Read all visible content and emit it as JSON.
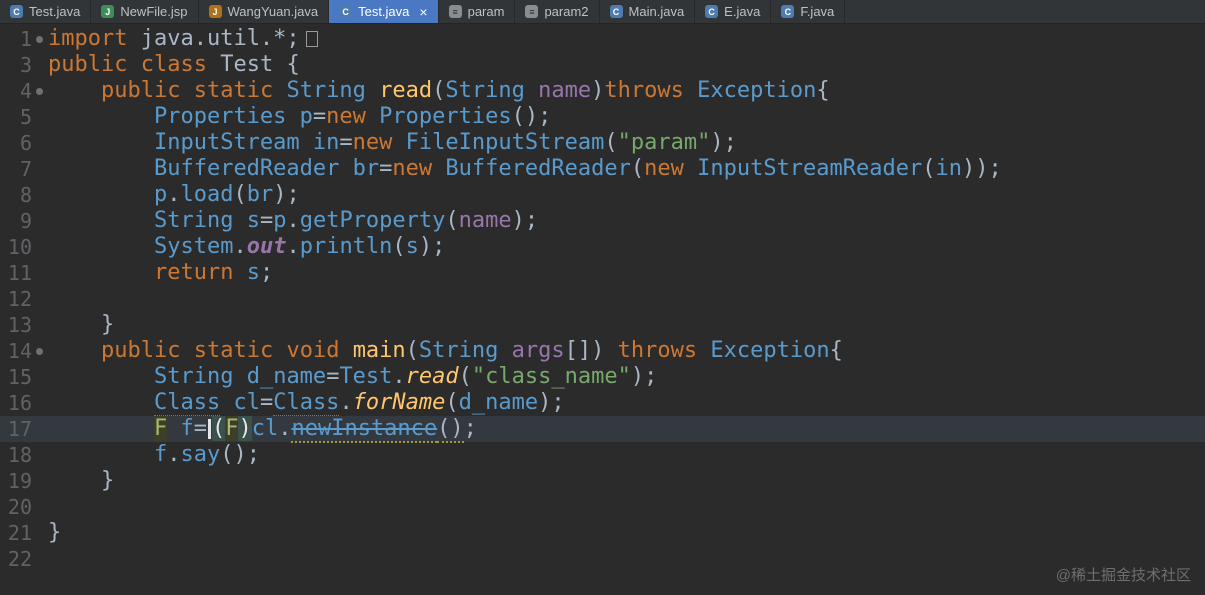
{
  "colors": {
    "editor_bg": "#2B2B2B",
    "tabbar_bg": "#313537",
    "tab_fg": "#BDC1C6",
    "active_tab_bg": "#4A78C2",
    "active_tab_fg": "#FFFFFF",
    "caret_row_bg": "#343940",
    "line_number": "#606366",
    "keyword": "#CC7832",
    "plain": "#A9B7C6",
    "identifier": "#5A9BCE",
    "string": "#79A86B",
    "method_decl": "#FFC66D",
    "static_method": "#FFC66D",
    "field": "#9876AA",
    "parameter": "#9876AA",
    "warn_underline": "#9D9D3A",
    "brace_match_bg": "#3B514D",
    "occurrence_bg": "#3D3E2A"
  },
  "tab_bar": {
    "tabs": [
      {
        "label": "Test.java",
        "icon": "java",
        "active": false
      },
      {
        "label": "NewFile.jsp",
        "icon": "jsp",
        "active": false
      },
      {
        "label": "WangYuan.java",
        "icon": "javafile",
        "active": false
      },
      {
        "label": "Test.java",
        "icon": "java",
        "active": true,
        "close": "×"
      },
      {
        "label": "param",
        "icon": "text",
        "active": false
      },
      {
        "label": "param2",
        "icon": "text",
        "active": false
      },
      {
        "label": "Main.java",
        "icon": "java",
        "active": false
      },
      {
        "label": "E.java",
        "icon": "java",
        "active": false
      },
      {
        "label": "F.java",
        "icon": "java",
        "active": false
      }
    ]
  },
  "editor": {
    "lines": [
      {
        "n": "1",
        "dot": true,
        "fold": true,
        "cur": false,
        "tokens": [
          [
            "kw",
            "import"
          ],
          [
            "pl",
            " java.util.*;"
          ],
          [
            "fold",
            ""
          ]
        ]
      },
      {
        "n": "3",
        "dot": false,
        "cur": false,
        "tokens": [
          [
            "kw",
            "public"
          ],
          [
            "pl",
            " "
          ],
          [
            "kw",
            "class"
          ],
          [
            "pl",
            " Test {"
          ]
        ]
      },
      {
        "n": "4",
        "dot": true,
        "cur": false,
        "tokens": [
          [
            "pl",
            "    "
          ],
          [
            "kw",
            "public"
          ],
          [
            "pl",
            " "
          ],
          [
            "kw",
            "static"
          ],
          [
            "pl",
            " "
          ],
          [
            "id",
            "String"
          ],
          [
            "pl",
            " "
          ],
          [
            "mdecl",
            "read"
          ],
          [
            "pl",
            "("
          ],
          [
            "id",
            "String"
          ],
          [
            "pl",
            " "
          ],
          [
            "prm",
            "name"
          ],
          [
            "pl",
            ")"
          ],
          [
            "kw",
            "throws"
          ],
          [
            "pl",
            " "
          ],
          [
            "id",
            "Exception"
          ],
          [
            "pl",
            "{"
          ]
        ]
      },
      {
        "n": "5",
        "dot": false,
        "cur": false,
        "tokens": [
          [
            "pl",
            "        "
          ],
          [
            "id",
            "Properties"
          ],
          [
            "pl",
            " "
          ],
          [
            "id",
            "p"
          ],
          [
            "pl",
            "="
          ],
          [
            "kw",
            "new"
          ],
          [
            "pl",
            " "
          ],
          [
            "id",
            "Properties"
          ],
          [
            "pl",
            "();"
          ]
        ]
      },
      {
        "n": "6",
        "dot": false,
        "cur": false,
        "tokens": [
          [
            "pl",
            "        "
          ],
          [
            "id",
            "InputStream"
          ],
          [
            "pl",
            " "
          ],
          [
            "id",
            "in"
          ],
          [
            "pl",
            "="
          ],
          [
            "kw",
            "new"
          ],
          [
            "pl",
            " "
          ],
          [
            "id",
            "FileInputStream"
          ],
          [
            "pl",
            "("
          ],
          [
            "str",
            "\"param\""
          ],
          [
            "pl",
            ");"
          ]
        ]
      },
      {
        "n": "7",
        "dot": false,
        "cur": false,
        "tokens": [
          [
            "pl",
            "        "
          ],
          [
            "id",
            "BufferedReader"
          ],
          [
            "pl",
            " "
          ],
          [
            "id",
            "br"
          ],
          [
            "pl",
            "="
          ],
          [
            "kw",
            "new"
          ],
          [
            "pl",
            " "
          ],
          [
            "id",
            "BufferedReader"
          ],
          [
            "pl",
            "("
          ],
          [
            "kw",
            "new"
          ],
          [
            "pl",
            " "
          ],
          [
            "id",
            "InputStreamReader"
          ],
          [
            "pl",
            "("
          ],
          [
            "id",
            "in"
          ],
          [
            "pl",
            "));"
          ]
        ]
      },
      {
        "n": "8",
        "dot": false,
        "cur": false,
        "tokens": [
          [
            "pl",
            "        "
          ],
          [
            "id",
            "p"
          ],
          [
            "pl",
            "."
          ],
          [
            "id",
            "load"
          ],
          [
            "pl",
            "("
          ],
          [
            "id",
            "br"
          ],
          [
            "pl",
            ");"
          ]
        ]
      },
      {
        "n": "9",
        "dot": false,
        "cur": false,
        "tokens": [
          [
            "pl",
            "        "
          ],
          [
            "id",
            "String"
          ],
          [
            "pl",
            " "
          ],
          [
            "id",
            "s"
          ],
          [
            "pl",
            "="
          ],
          [
            "id",
            "p"
          ],
          [
            "pl",
            "."
          ],
          [
            "id",
            "getProperty"
          ],
          [
            "pl",
            "("
          ],
          [
            "prm",
            "name"
          ],
          [
            "pl",
            ");"
          ]
        ]
      },
      {
        "n": "10",
        "dot": false,
        "cur": false,
        "tokens": [
          [
            "pl",
            "        "
          ],
          [
            "id",
            "System"
          ],
          [
            "pl",
            "."
          ],
          [
            "fld",
            "out"
          ],
          [
            "pl",
            "."
          ],
          [
            "id",
            "println"
          ],
          [
            "pl",
            "("
          ],
          [
            "id",
            "s"
          ],
          [
            "pl",
            ");"
          ]
        ]
      },
      {
        "n": "11",
        "dot": false,
        "cur": false,
        "tokens": [
          [
            "pl",
            "        "
          ],
          [
            "kw",
            "return"
          ],
          [
            "pl",
            " "
          ],
          [
            "id",
            "s"
          ],
          [
            "pl",
            ";"
          ]
        ]
      },
      {
        "n": "12",
        "dot": false,
        "cur": false,
        "tokens": []
      },
      {
        "n": "13",
        "dot": false,
        "cur": false,
        "tokens": [
          [
            "pl",
            "    }"
          ]
        ]
      },
      {
        "n": "14",
        "dot": true,
        "cur": false,
        "tokens": [
          [
            "pl",
            "    "
          ],
          [
            "kw",
            "public"
          ],
          [
            "pl",
            " "
          ],
          [
            "kw",
            "static"
          ],
          [
            "pl",
            " "
          ],
          [
            "kw",
            "void"
          ],
          [
            "pl",
            " "
          ],
          [
            "mdecl",
            "main"
          ],
          [
            "pl",
            "("
          ],
          [
            "id",
            "String"
          ],
          [
            "pl",
            " "
          ],
          [
            "prm",
            "args"
          ],
          [
            "pl",
            "[]) "
          ],
          [
            "kw",
            "throws"
          ],
          [
            "pl",
            " "
          ],
          [
            "id",
            "Exception"
          ],
          [
            "pl",
            "{"
          ]
        ]
      },
      {
        "n": "15",
        "dot": false,
        "cur": false,
        "tokens": [
          [
            "pl",
            "        "
          ],
          [
            "id",
            "String"
          ],
          [
            "pl",
            " "
          ],
          [
            "id",
            "d_name"
          ],
          [
            "pl",
            "="
          ],
          [
            "id",
            "Test"
          ],
          [
            "pl",
            "."
          ],
          [
            "smeth",
            "read"
          ],
          [
            "pl",
            "("
          ],
          [
            "str",
            "\"class_name\""
          ],
          [
            "pl",
            ");"
          ]
        ]
      },
      {
        "n": "16",
        "dot": false,
        "cur": false,
        "tokens": [
          [
            "pl",
            "        "
          ],
          [
            "idw",
            "Class"
          ],
          [
            "pl",
            " "
          ],
          [
            "id",
            "cl"
          ],
          [
            "pl",
            "="
          ],
          [
            "idw",
            "Class"
          ],
          [
            "pl",
            "."
          ],
          [
            "smeth",
            "forName"
          ],
          [
            "pl",
            "("
          ],
          [
            "id",
            "d_name"
          ],
          [
            "pl",
            ");"
          ]
        ]
      },
      {
        "n": "17",
        "dot": false,
        "cur": true,
        "tokens": [
          [
            "pl",
            "        "
          ],
          [
            "fhl",
            "F"
          ],
          [
            "pl",
            " "
          ],
          [
            "id",
            "f"
          ],
          [
            "pl",
            "="
          ],
          [
            "caret",
            ""
          ],
          [
            "brhl",
            "("
          ],
          [
            "fhl",
            "F"
          ],
          [
            "brhl",
            ")"
          ],
          [
            "id",
            "cl"
          ],
          [
            "pl",
            "."
          ],
          [
            "dep",
            "newInstance"
          ],
          [
            "wav",
            "()"
          ],
          [
            "pl",
            ";"
          ]
        ]
      },
      {
        "n": "18",
        "dot": false,
        "cur": false,
        "tokens": [
          [
            "pl",
            "        "
          ],
          [
            "id",
            "f"
          ],
          [
            "pl",
            "."
          ],
          [
            "id",
            "say"
          ],
          [
            "pl",
            "();"
          ]
        ]
      },
      {
        "n": "19",
        "dot": false,
        "cur": false,
        "tokens": [
          [
            "pl",
            "    }"
          ]
        ]
      },
      {
        "n": "20",
        "dot": false,
        "cur": false,
        "tokens": []
      },
      {
        "n": "21",
        "dot": false,
        "cur": false,
        "tokens": [
          [
            "pl",
            "}"
          ]
        ]
      },
      {
        "n": "22",
        "dot": false,
        "cur": false,
        "tokens": []
      }
    ]
  },
  "watermark": "@稀土掘金技术社区"
}
